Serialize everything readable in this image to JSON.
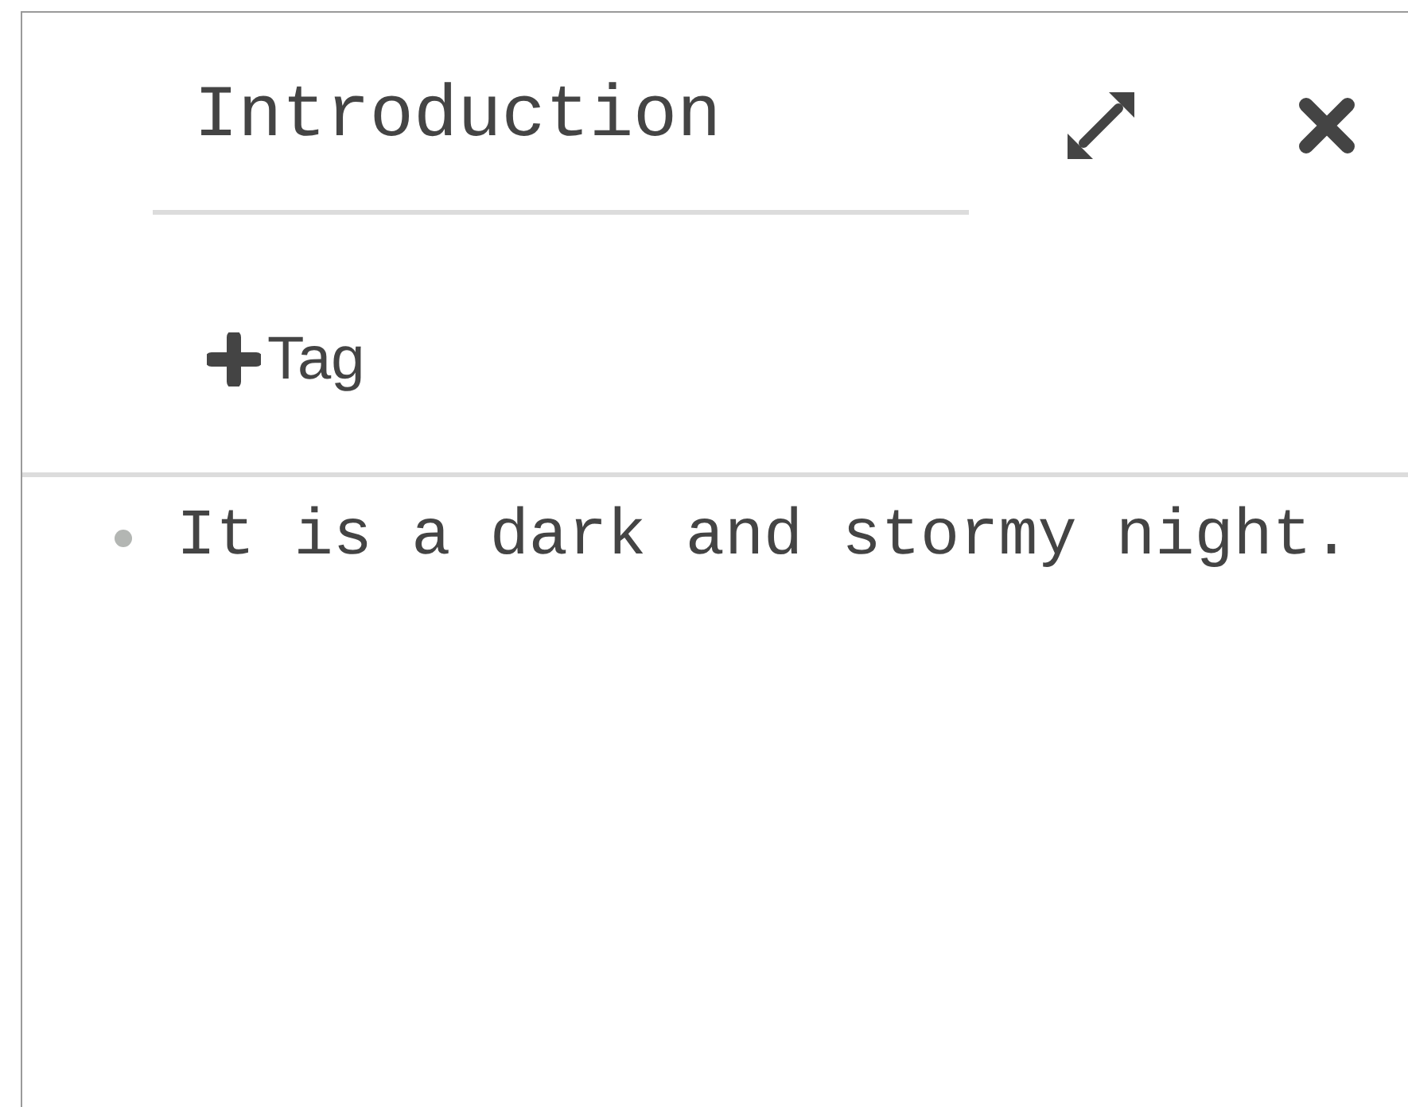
{
  "title": "Introduction",
  "tag_button": {
    "label": "Tag"
  },
  "bullets": [
    {
      "text": "It is a dark and stormy night."
    }
  ]
}
